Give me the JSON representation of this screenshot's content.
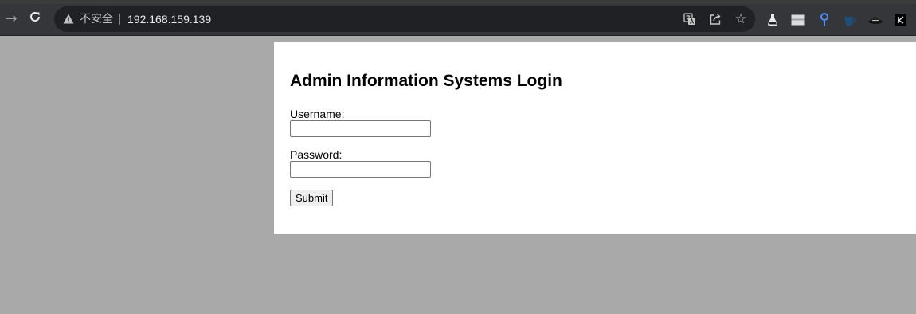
{
  "browser": {
    "address_bar": {
      "security_label": "不安全",
      "url": "192.168.159.139"
    },
    "icons": {
      "forward": "arrow-right-icon",
      "reload": "reload-icon",
      "warning": "warning-triangle-icon",
      "translate": "translate-icon",
      "share": "share-icon",
      "bookmark": "star-icon"
    },
    "extensions": [
      "ink-bottle-icon",
      "window-icon",
      "pin-icon",
      "teacup-icon",
      "hat-icon",
      "k-icon"
    ]
  },
  "page": {
    "title": "Admin Information Systems Login",
    "username_label": "Username:",
    "username_value": "",
    "password_label": "Password:",
    "password_value": "",
    "submit_label": "Submit"
  },
  "colors": {
    "page_background": "#a9a9a9",
    "panel_background": "#ffffff",
    "toolbar_background": "#35363a"
  }
}
